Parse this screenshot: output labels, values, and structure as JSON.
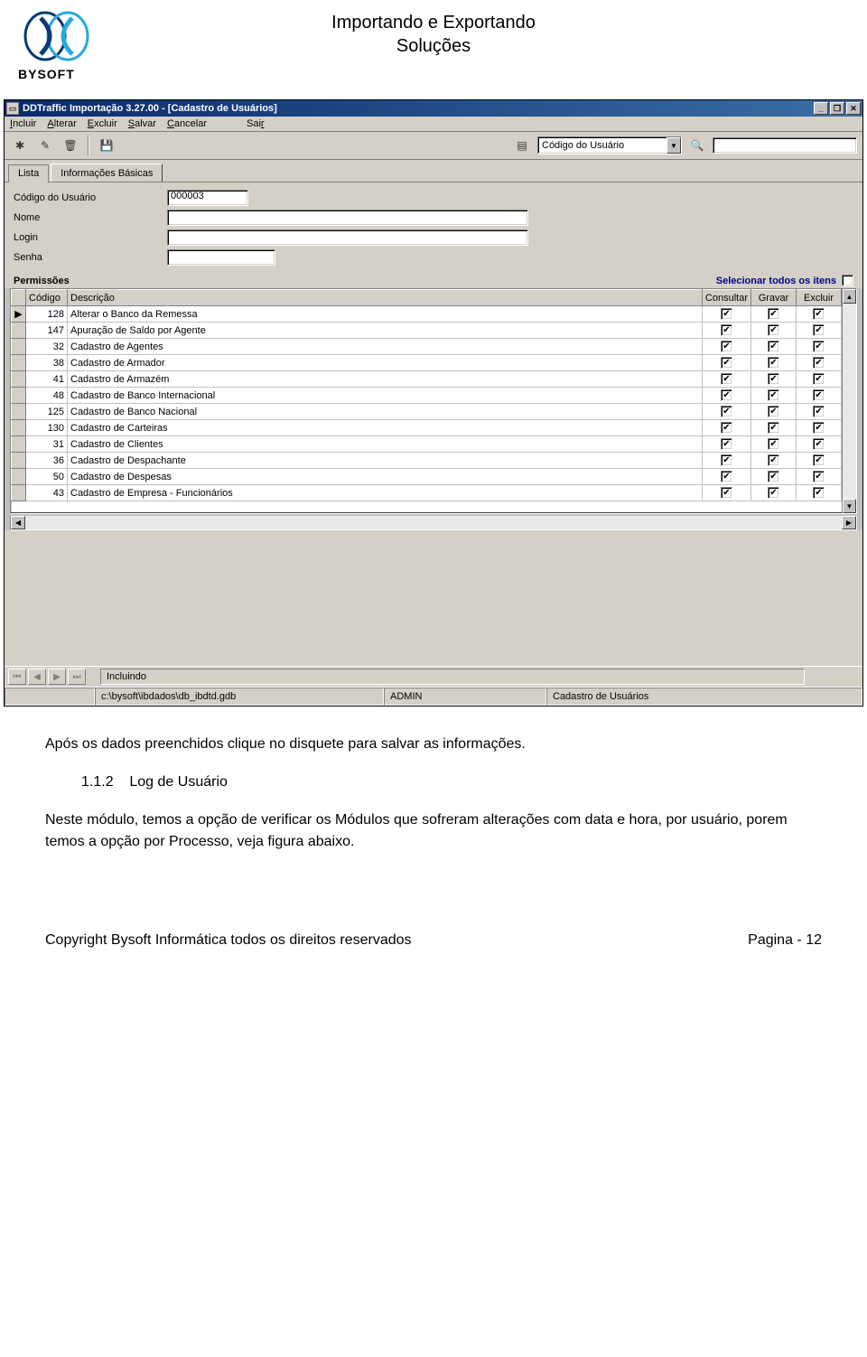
{
  "doc": {
    "header_line1": "Importando e Exportando",
    "header_line2": "Soluções",
    "logo_text": "BYSOFT"
  },
  "app": {
    "window_title": "DDTraffic Importação 3.27.00 - [Cadastro de Usuários]",
    "menu": {
      "incluir": "Incluir",
      "alterar": "Alterar",
      "excluir": "Excluir",
      "salvar": "Salvar",
      "cancelar": "Cancelar",
      "sair": "Sair"
    },
    "search_combo": "Código do Usuário",
    "tabs": {
      "lista": "Lista",
      "info": "Informações Básicas"
    },
    "form": {
      "codigo_label": "Código do Usuário",
      "codigo_value": "000003",
      "nome_label": "Nome",
      "nome_value": "",
      "login_label": "Login",
      "login_value": "",
      "senha_label": "Senha",
      "senha_value": ""
    },
    "perm": {
      "title": "Permissões",
      "select_all_label": "Selecionar todos os itens",
      "select_all_checked": false,
      "cols": {
        "codigo": "Código",
        "descricao": "Descrição",
        "consultar": "Consultar",
        "gravar": "Gravar",
        "excluir": "Excluir"
      },
      "rows": [
        {
          "sel": "▶",
          "codigo": "128",
          "descricao": "Alterar o Banco da Remessa",
          "consultar": true,
          "gravar": true,
          "excluir": true
        },
        {
          "sel": "",
          "codigo": "147",
          "descricao": "Apuração de Saldo por Agente",
          "consultar": true,
          "gravar": true,
          "excluir": true
        },
        {
          "sel": "",
          "codigo": "32",
          "descricao": "Cadastro de Agentes",
          "consultar": true,
          "gravar": true,
          "excluir": true
        },
        {
          "sel": "",
          "codigo": "38",
          "descricao": "Cadastro de Armador",
          "consultar": true,
          "gravar": true,
          "excluir": true
        },
        {
          "sel": "",
          "codigo": "41",
          "descricao": "Cadastro de Armazém",
          "consultar": true,
          "gravar": true,
          "excluir": true
        },
        {
          "sel": "",
          "codigo": "48",
          "descricao": "Cadastro de Banco Internacional",
          "consultar": true,
          "gravar": true,
          "excluir": true
        },
        {
          "sel": "",
          "codigo": "125",
          "descricao": "Cadastro de Banco Nacional",
          "consultar": true,
          "gravar": true,
          "excluir": true
        },
        {
          "sel": "",
          "codigo": "130",
          "descricao": "Cadastro de Carteiras",
          "consultar": true,
          "gravar": true,
          "excluir": true
        },
        {
          "sel": "",
          "codigo": "31",
          "descricao": "Cadastro de Clientes",
          "consultar": true,
          "gravar": true,
          "excluir": true
        },
        {
          "sel": "",
          "codigo": "36",
          "descricao": "Cadastro de Despachante",
          "consultar": true,
          "gravar": true,
          "excluir": true
        },
        {
          "sel": "",
          "codigo": "50",
          "descricao": "Cadastro de Despesas",
          "consultar": true,
          "gravar": true,
          "excluir": true
        },
        {
          "sel": "",
          "codigo": "43",
          "descricao": "Cadastro de Empresa - Funcionários",
          "consultar": true,
          "gravar": true,
          "excluir": true
        }
      ]
    },
    "nav_status": "Incluindo",
    "status": {
      "path": "c:\\bysoft\\ibdados\\db_ibdtd.gdb",
      "user": "ADMIN",
      "module": "Cadastro de Usuários"
    }
  },
  "body": {
    "p1": "Após os dados preenchidos clique no disquete para salvar as informações.",
    "sec_num": "1.1.2",
    "sec_title": "Log de Usuário",
    "p2": "Neste módulo, temos a opção de verificar os Módulos que sofreram alterações com data e hora, por usuário, porem temos a opção por Processo, veja figura abaixo."
  },
  "footer": {
    "copyright": "Copyright Bysoft Informática todos os direitos reservados",
    "page": "Pagina - 12"
  }
}
